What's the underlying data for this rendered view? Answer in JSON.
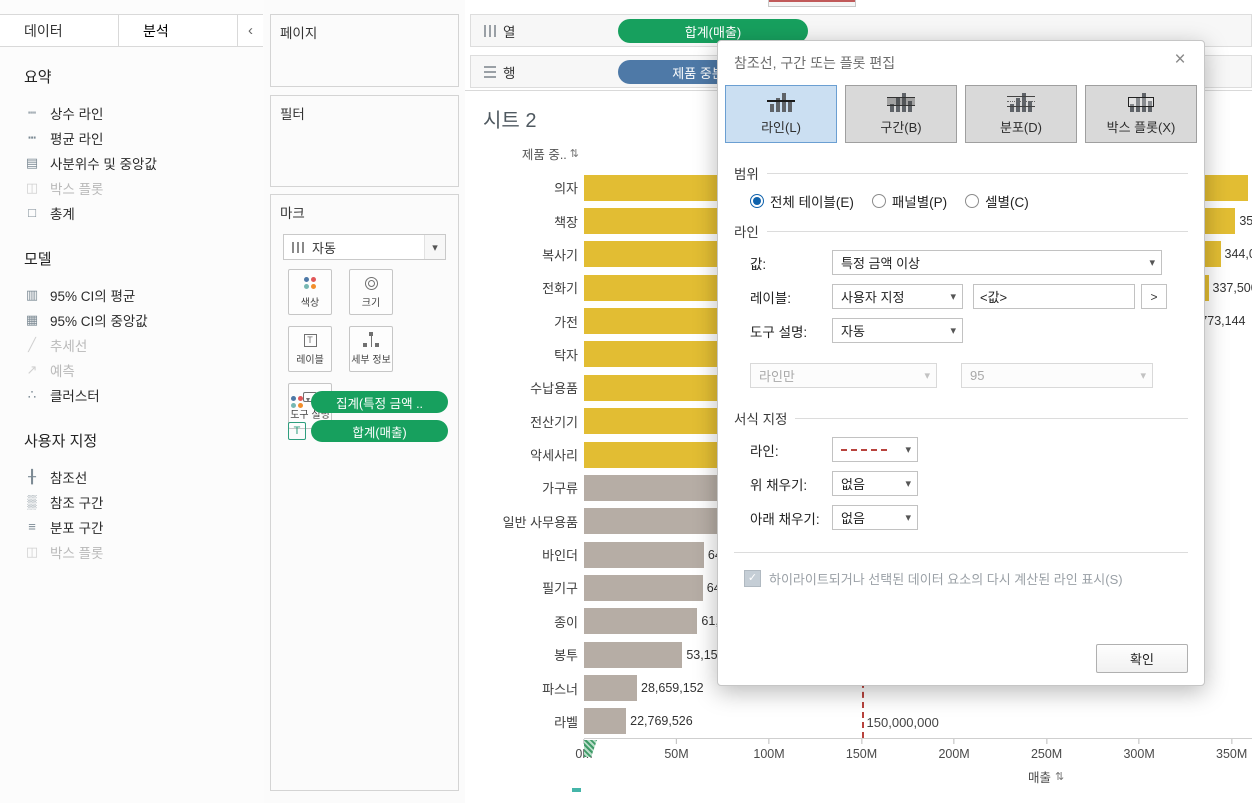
{
  "icons": {
    "chevron_down": "▾",
    "close": "×",
    "collapse": "‹",
    "sort": "⇅",
    "check": "✓"
  },
  "left_panel": {
    "tabs": [
      {
        "label": "데이터"
      },
      {
        "label": "분석"
      }
    ],
    "summary": {
      "title": "요약",
      "items": [
        {
          "label": "상수 라인",
          "glyph": "┉",
          "icon": "constant-line-icon",
          "enabled": true
        },
        {
          "label": "평균 라인",
          "glyph": "┅",
          "icon": "average-line-icon",
          "enabled": true
        },
        {
          "label": "사분위수 및 중앙값",
          "glyph": "▤",
          "icon": "quartiles-median-icon",
          "enabled": true
        },
        {
          "label": "박스 플롯",
          "glyph": "◫",
          "icon": "box-plot-icon",
          "enabled": false
        },
        {
          "label": "총계",
          "glyph": "□",
          "icon": "totals-icon",
          "enabled": true
        }
      ]
    },
    "model": {
      "title": "모델",
      "items": [
        {
          "label": "95% CI의 평균",
          "glyph": "▥",
          "icon": "ci-average-icon",
          "enabled": true
        },
        {
          "label": "95% CI의 중앙값",
          "glyph": "▦",
          "icon": "ci-median-icon",
          "enabled": true
        },
        {
          "label": "추세선",
          "glyph": "╱",
          "icon": "trend-line-icon",
          "enabled": false
        },
        {
          "label": "예측",
          "glyph": "↗",
          "icon": "forecast-icon",
          "enabled": false
        },
        {
          "label": "클러스터",
          "glyph": "∴",
          "icon": "cluster-icon",
          "enabled": true
        }
      ]
    },
    "custom": {
      "title": "사용자 지정",
      "items": [
        {
          "label": "참조선",
          "glyph": "╂",
          "icon": "reference-line-icon",
          "enabled": true
        },
        {
          "label": "참조 구간",
          "glyph": "▒",
          "icon": "reference-band-icon",
          "enabled": true
        },
        {
          "label": "분포 구간",
          "glyph": "≡",
          "icon": "distribution-band-icon",
          "enabled": true
        },
        {
          "label": "박스 플롯",
          "glyph": "◫",
          "icon": "box-plot-icon",
          "enabled": false
        }
      ]
    }
  },
  "cards": {
    "pages_title": "페이지",
    "filters_title": "필터",
    "marks_title": "마크",
    "mark_type": "자동",
    "mark_buttons": [
      {
        "label": "색상",
        "icon": "color"
      },
      {
        "label": "크기",
        "icon": "size"
      },
      {
        "label": "레이블",
        "icon": "label"
      },
      {
        "label": "세부 정보",
        "icon": "detail"
      },
      {
        "label": "도구 설명",
        "icon": "tooltip"
      }
    ],
    "pills": [
      {
        "label": "집계(특정 금액 ..",
        "icon": "colordots"
      },
      {
        "label": "합계(매출)",
        "icon": "tbox"
      }
    ]
  },
  "shelves": {
    "columns_label": "열",
    "columns_pill": "합계(매출)",
    "rows_label": "행",
    "rows_pill": "제품 중분류"
  },
  "dialog": {
    "title": "참조선, 구간 또는 플롯 편집",
    "types": [
      {
        "label": "라인(L)",
        "icon": "line",
        "selected": true
      },
      {
        "label": "구간(B)",
        "icon": "band",
        "selected": false
      },
      {
        "label": "분포(D)",
        "icon": "dist",
        "selected": false
      },
      {
        "label": "박스 플롯(X)",
        "icon": "box",
        "selected": false
      }
    ],
    "scope": {
      "title": "범위",
      "options": [
        {
          "label": "전체 테이블(E)",
          "selected": true
        },
        {
          "label": "패널별(P)",
          "selected": false
        },
        {
          "label": "셀별(C)",
          "selected": false
        }
      ]
    },
    "line_section": {
      "title": "라인",
      "value_label": "값:",
      "value_dropdown": "특정 금액 이상",
      "label_label": "레이블:",
      "label_dropdown": "사용자 지정",
      "label_input": "<값>",
      "label_button": ">",
      "tooltip_label": "도구 설명:",
      "tooltip_dropdown": "자동",
      "disabled_dropdown1": "라인만",
      "disabled_dropdown2": "95"
    },
    "format_section": {
      "title": "서식 지정",
      "line_label": "라인:",
      "fill_above_label": "위 채우기:",
      "fill_above_value": "없음",
      "fill_below_label": "아래 채우기:",
      "fill_below_value": "없음"
    },
    "checkbox_label": "하이라이트되거나 선택된 데이터 요소의 다시 계산된 라인 표시(S)",
    "ok_label": "확인"
  },
  "chart_data": {
    "type": "bar",
    "orientation": "horizontal",
    "title": "시트 2",
    "row_header": "제품 중..",
    "xlabel": "매출",
    "categories": [
      "의자",
      "책장",
      "복사기",
      "전화기",
      "가전",
      "탁자",
      "수납용품",
      "전산기기",
      "악세사리",
      "가구류",
      "일반 사무용품",
      "바인더",
      "필기구",
      "종이",
      "봉투",
      "파스너",
      "라벨"
    ],
    "values": [
      358900000,
      352000000,
      344000000,
      337500000,
      317773144,
      255000000,
      237000000,
      218000000,
      187000000,
      138000000,
      118000000,
      64800000,
      64200000,
      61300000,
      53155000,
      28659152,
      22769526
    ],
    "threshold": 150000000,
    "colors": {
      "above": "#e2bd33",
      "below": "#b6ada5"
    },
    "reference_line": {
      "value": 150000000,
      "label": "150,000,000",
      "color": "#b8433e",
      "style": "dashed"
    },
    "x_ticks": [
      {
        "value": 0,
        "label": "0M"
      },
      {
        "value": 50,
        "label": "50M"
      },
      {
        "value": 100,
        "label": "100M"
      },
      {
        "value": 150,
        "label": "150M"
      },
      {
        "value": 200,
        "label": "200M"
      },
      {
        "value": 250,
        "label": "250M"
      },
      {
        "value": 300,
        "label": "300M"
      },
      {
        "value": 350,
        "label": "350M"
      }
    ],
    "xlim": [
      0,
      361000000
    ],
    "grid": false,
    "legend": "none"
  }
}
